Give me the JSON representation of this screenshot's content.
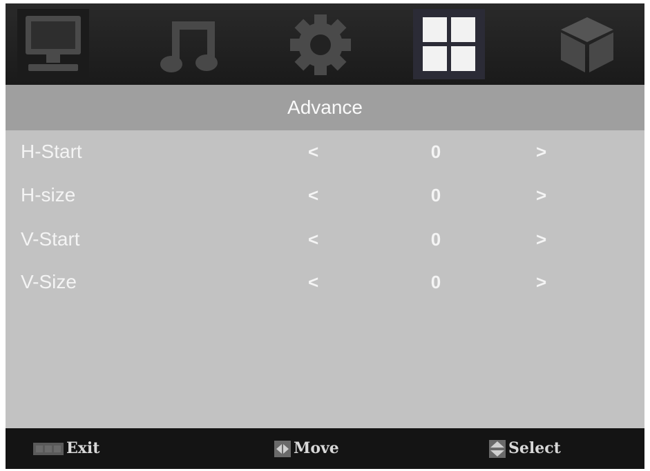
{
  "menu": {
    "tabs": [
      {
        "name": "picture",
        "icon": "monitor-icon"
      },
      {
        "name": "sound",
        "icon": "music-note-icon"
      },
      {
        "name": "setup",
        "icon": "gear-icon"
      },
      {
        "name": "advance",
        "icon": "window-grid-icon",
        "selected": true
      },
      {
        "name": "extras",
        "icon": "cube-icon"
      }
    ],
    "title": "Advance",
    "rows": [
      {
        "label": "H-Start",
        "left": "<",
        "value": "0",
        "right": ">"
      },
      {
        "label": "H-size",
        "left": "<",
        "value": "0",
        "right": ">"
      },
      {
        "label": "V-Start",
        "left": "<",
        "value": "0",
        "right": ">"
      },
      {
        "label": "V-Size",
        "left": "<",
        "value": "0",
        "right": ">"
      }
    ]
  },
  "footer": {
    "exit": {
      "icon": "menu-key-icon",
      "label": "Exit"
    },
    "move": {
      "icon": "left-right-arrows-icon",
      "label": "Move"
    },
    "select": {
      "icon": "up-down-arrows-icon",
      "label": "Select"
    }
  }
}
